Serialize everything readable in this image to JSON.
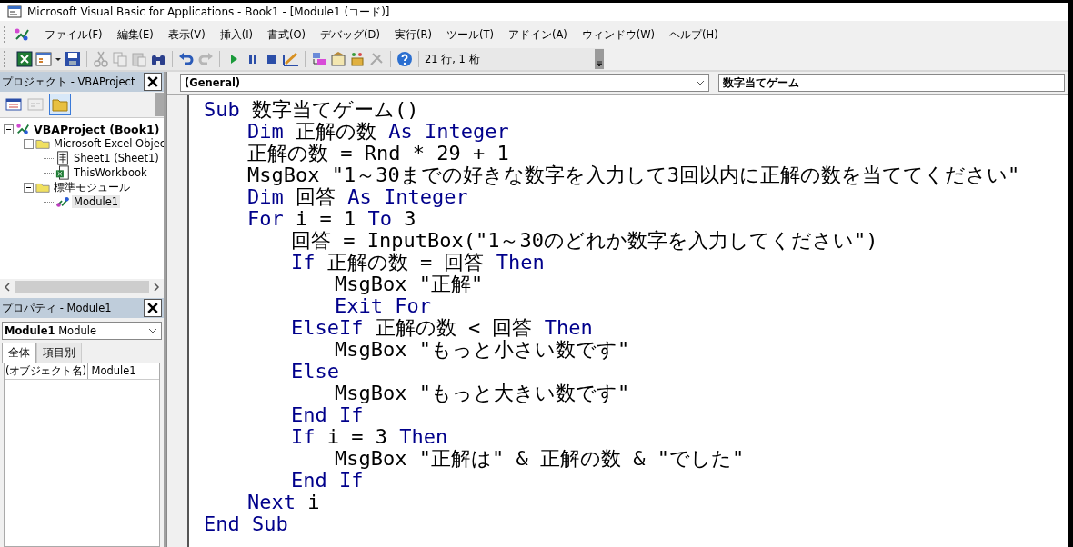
{
  "window": {
    "title": "Microsoft Visual Basic for Applications - Book1 - [Module1 (コード)]"
  },
  "menu": [
    "ファイル(F)",
    "編集(E)",
    "表示(V)",
    "挿入(I)",
    "書式(O)",
    "デバッグ(D)",
    "実行(R)",
    "ツール(T)",
    "アドイン(A)",
    "ウィンドウ(W)",
    "ヘルプ(H)"
  ],
  "toolbar": {
    "position": "21 行, 1 桁"
  },
  "project": {
    "title": "プロジェクト - VBAProject",
    "tree": [
      {
        "label": "VBAProject (Book1)",
        "kind": "project",
        "expanded": true,
        "selected": false,
        "children": [
          {
            "label": "Microsoft Excel Objec",
            "kind": "folder",
            "expanded": true,
            "selected": false,
            "children": [
              {
                "label": "Sheet1 (Sheet1)",
                "kind": "sheet",
                "selected": false
              },
              {
                "label": "ThisWorkbook",
                "kind": "workbook",
                "selected": false
              }
            ]
          },
          {
            "label": "標準モジュール",
            "kind": "folder",
            "expanded": true,
            "selected": false,
            "children": [
              {
                "label": "Module1",
                "kind": "module",
                "selected": true
              }
            ]
          }
        ]
      }
    ]
  },
  "properties": {
    "title": "プロパティ - Module1",
    "object": "**Module1** Module",
    "tabs": [
      {
        "label": "全体",
        "selected": true
      },
      {
        "label": "項目別",
        "selected": false
      }
    ],
    "rows": [
      {
        "name": "(オブジェクト名)",
        "value": "Module1"
      }
    ]
  },
  "code": {
    "object": "(General)",
    "procedure": "数字当てゲーム",
    "lines": [
      {
        "tokens": [
          {
            "kind": "keyword",
            "text": "Sub"
          },
          {
            "kind": "plain",
            "text": " 数字当てゲーム()"
          }
        ],
        "children": [
          {
            "tokens": [
              {
                "kind": "keyword",
                "text": "Dim"
              },
              {
                "kind": "plain",
                "text": " 正解の数 "
              },
              {
                "kind": "keyword",
                "text": "As Integer"
              }
            ]
          },
          {
            "tokens": [
              {
                "kind": "plain",
                "text": "正解の数 = Rnd * 29 + 1"
              }
            ]
          },
          {
            "tokens": [
              {
                "kind": "plain",
                "text": "MsgBox \"1～30までの好きな数字を入力して3回以内に正解の数を当ててください\""
              }
            ]
          },
          {
            "tokens": [
              {
                "kind": "keyword",
                "text": "Dim"
              },
              {
                "kind": "plain",
                "text": " 回答 "
              },
              {
                "kind": "keyword",
                "text": "As Integer"
              }
            ]
          },
          {
            "tokens": [
              {
                "kind": "keyword",
                "text": "For"
              },
              {
                "kind": "plain",
                "text": " i = 1 "
              },
              {
                "kind": "keyword",
                "text": "To"
              },
              {
                "kind": "plain",
                "text": " 3"
              }
            ],
            "children": [
              {
                "tokens": [
                  {
                    "kind": "plain",
                    "text": "回答 = InputBox(\"1～30のどれか数字を入力してください\")"
                  }
                ]
              },
              {
                "tokens": [
                  {
                    "kind": "keyword",
                    "text": "If"
                  },
                  {
                    "kind": "plain",
                    "text": " 正解の数 = 回答 "
                  },
                  {
                    "kind": "keyword",
                    "text": "Then"
                  }
                ],
                "children": [
                  {
                    "tokens": [
                      {
                        "kind": "plain",
                        "text": "MsgBox \"正解\""
                      }
                    ]
                  },
                  {
                    "tokens": [
                      {
                        "kind": "keyword",
                        "text": "Exit For"
                      }
                    ]
                  }
                ]
              },
              {
                "tokens": [
                  {
                    "kind": "keyword",
                    "text": "ElseIf"
                  },
                  {
                    "kind": "plain",
                    "text": " 正解の数 < 回答 "
                  },
                  {
                    "kind": "keyword",
                    "text": "Then"
                  }
                ],
                "children": [
                  {
                    "tokens": [
                      {
                        "kind": "plain",
                        "text": "MsgBox \"もっと小さい数です\""
                      }
                    ]
                  }
                ]
              },
              {
                "tokens": [
                  {
                    "kind": "keyword",
                    "text": "Else"
                  }
                ],
                "children": [
                  {
                    "tokens": [
                      {
                        "kind": "plain",
                        "text": "MsgBox \"もっと大きい数です\""
                      }
                    ]
                  }
                ]
              },
              {
                "tokens": [
                  {
                    "kind": "keyword",
                    "text": "End If"
                  }
                ]
              },
              {
                "tokens": [
                  {
                    "kind": "keyword",
                    "text": "If"
                  },
                  {
                    "kind": "plain",
                    "text": " i = 3 "
                  },
                  {
                    "kind": "keyword",
                    "text": "Then"
                  }
                ],
                "children": [
                  {
                    "tokens": [
                      {
                        "kind": "plain",
                        "text": "MsgBox \"正解は\" & 正解の数 & \"でした\""
                      }
                    ]
                  }
                ]
              },
              {
                "tokens": [
                  {
                    "kind": "keyword",
                    "text": "End If"
                  }
                ]
              }
            ]
          },
          {
            "tokens": [
              {
                "kind": "keyword",
                "text": "Next"
              },
              {
                "kind": "plain",
                "text": " i"
              }
            ]
          }
        ]
      },
      {
        "tokens": [
          {
            "kind": "keyword",
            "text": "End Sub"
          }
        ]
      }
    ]
  }
}
